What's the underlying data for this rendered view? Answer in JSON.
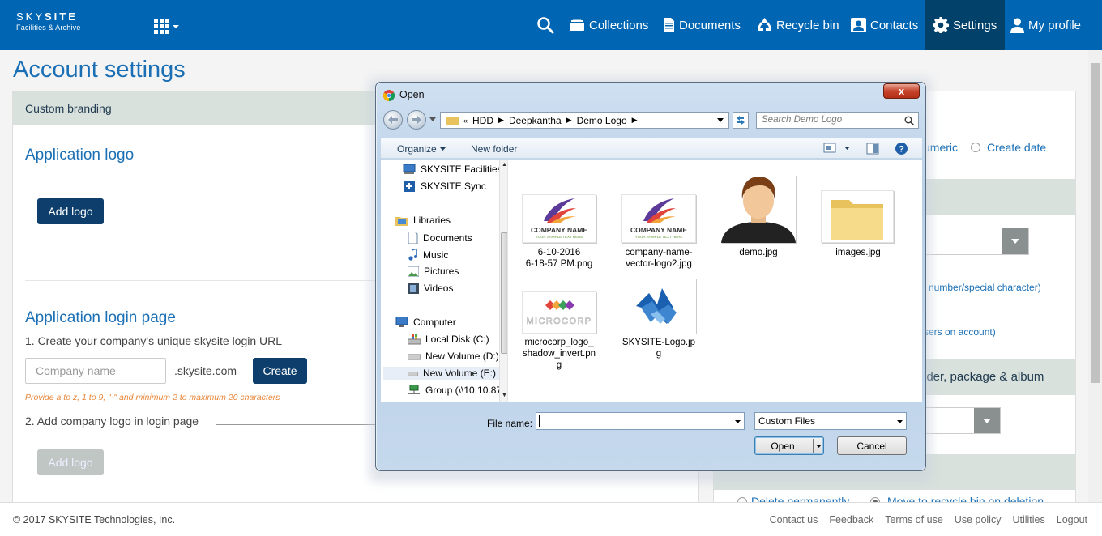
{
  "brand": {
    "name_light": "SKY",
    "name_bold": "SITE",
    "tagline": "Facilities & Archive"
  },
  "nav": {
    "collections": "Collections",
    "documents": "Documents",
    "recycle": "Recycle bin",
    "contacts": "Contacts",
    "settings": "Settings",
    "profile": "My profile"
  },
  "page": {
    "title": "Account settings"
  },
  "custom_branding": {
    "header": "Custom branding",
    "app_logo_title": "Application logo",
    "add_logo": "Add logo",
    "login_title": "Application login page",
    "step1": "1. Create your company's unique skysite login URL",
    "company_placeholder": "Company name",
    "domain_suffix": ".skysite.com",
    "create": "Create",
    "hint": "Provide a to z, 1 to 9, \"-\" and minimum 2 to maximum 20 characters",
    "step2": "2. Add company logo in login page",
    "add_logo_2": "Add logo"
  },
  "right": {
    "sort_numeric_partial": "umeric",
    "create_date": "Create date",
    "pw_hint_partial": "number/special character)",
    "users_partial": "sers on account)",
    "folder_header_partial": "lder, package & album",
    "delete_permanently": "Delete permanently",
    "move_recycle": "Move to recycle bin on deletion"
  },
  "dialog": {
    "title": "Open",
    "close": "x",
    "path": [
      "HDD",
      "Deepkantha",
      "Demo Logo"
    ],
    "path_prefix": "«",
    "search_placeholder": "Search Demo Logo",
    "organize": "Organize",
    "new_folder": "New folder",
    "tree": [
      {
        "label": "SKYSITE Facilities"
      },
      {
        "label": "SKYSITE Sync"
      },
      {
        "label": "Libraries"
      },
      {
        "label": "Documents"
      },
      {
        "label": "Music"
      },
      {
        "label": "Pictures"
      },
      {
        "label": "Videos"
      },
      {
        "label": "Computer"
      },
      {
        "label": "Local Disk (C:)"
      },
      {
        "label": "New Volume (D:)"
      },
      {
        "label": "New Volume (E:)"
      },
      {
        "label": "Group (\\\\10.10.87"
      }
    ],
    "files": [
      {
        "name": "6-10-2016\n6-18-57 PM.png",
        "logo_text": "COMPANY NAME",
        "logo_sub": "YOUR SAMPLE TEXT HERE"
      },
      {
        "name": "company-name-\nvector-logo2.jpg",
        "logo_text": "COMPANY NAME",
        "logo_sub": "YOUR SAMPLE TEXT HERE"
      },
      {
        "name": "demo.jpg"
      },
      {
        "name": "images.jpg"
      },
      {
        "name": "microcorp_logo_\nshadow_invert.pn\ng",
        "logo_text": "MICROCORP"
      },
      {
        "name": "SKYSITE-Logo.jp\ng"
      }
    ],
    "file_name_label": "File name:",
    "file_name_value": "",
    "file_type": "Custom Files",
    "open": "Open",
    "cancel": "Cancel"
  },
  "footer": {
    "copyright": "© 2017 SKYSITE Technologies, Inc.",
    "links": [
      "Contact us",
      "Feedback",
      "Terms of use",
      "Use policy",
      "Utilities",
      "Logout"
    ]
  },
  "colors": {
    "nav_bg": "#0066b3",
    "nav_active": "#01416a",
    "accent": "#1a6fb5",
    "button_dark": "#0e3f6c",
    "hint": "#e8873a"
  }
}
